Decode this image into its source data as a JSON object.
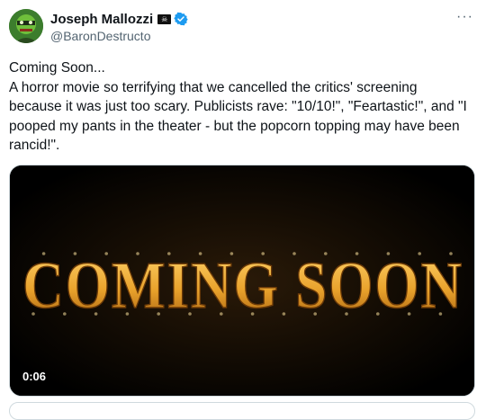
{
  "author": {
    "name": "Joseph Mallozzi",
    "flag_emoji": "☠",
    "handle": "@BaronDestructo"
  },
  "tweet": {
    "text": "Coming Soon...\nA horror movie so terrifying that we cancelled the critics' screening because it was just too scary.  Publicists rave: \"10/10!\", \"Feartastic!\", and \"I pooped my pants in the theater - but the popcorn topping may have been rancid!\"."
  },
  "media": {
    "title": "COMING SOON",
    "duration": "0:06"
  },
  "icons": {
    "verified": "verified-badge-icon",
    "more": "more-options-icon",
    "flag": "pirate-flag-icon"
  },
  "colors": {
    "verified": "#1d9bf0",
    "handle": "#536471",
    "marquee_gold": "#f2b233"
  }
}
